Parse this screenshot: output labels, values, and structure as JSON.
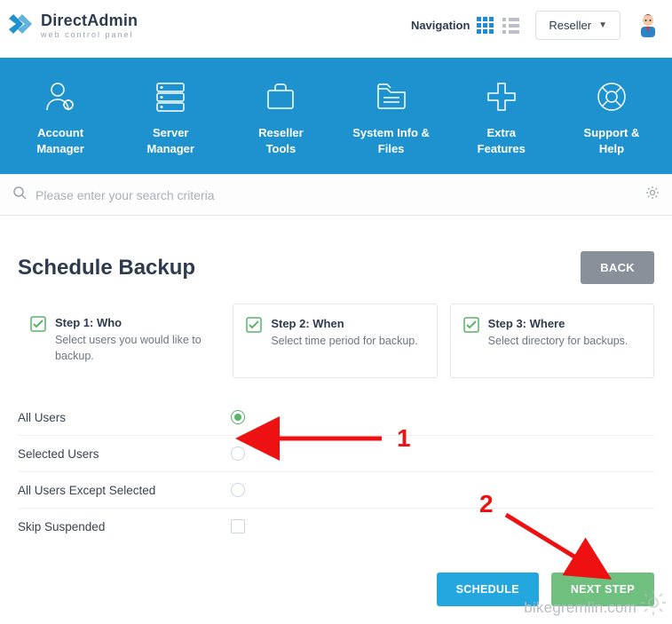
{
  "brand": {
    "main": "Direct",
    "bold": "Admin",
    "tagline": "web control panel"
  },
  "header": {
    "nav_label": "Navigation",
    "role": "Reseller"
  },
  "tiles": [
    "Account Manager",
    "Server Manager",
    "Reseller Tools",
    "System Info & Files",
    "Extra Features",
    "Support & Help"
  ],
  "search": {
    "placeholder": "Please enter your search criteria"
  },
  "page": {
    "title": "Schedule Backup",
    "back": "BACK"
  },
  "steps": [
    {
      "title": "Step 1: Who",
      "sub": "Select users you would like to backup."
    },
    {
      "title": "Step 2: When",
      "sub": "Select time period for backup."
    },
    {
      "title": "Step 3: Where",
      "sub": "Select directory for backups."
    }
  ],
  "who_options": [
    {
      "label": "All Users",
      "kind": "radio",
      "checked": true
    },
    {
      "label": "Selected Users",
      "kind": "radio",
      "checked": false
    },
    {
      "label": "All Users Except Selected",
      "kind": "radio",
      "checked": false
    },
    {
      "label": "Skip Suspended",
      "kind": "check",
      "checked": false
    }
  ],
  "actions": {
    "schedule": "SCHEDULE",
    "next": "NEXT STEP"
  },
  "annotations": {
    "one": "1",
    "two": "2"
  },
  "watermark": "bikegremlin.com"
}
